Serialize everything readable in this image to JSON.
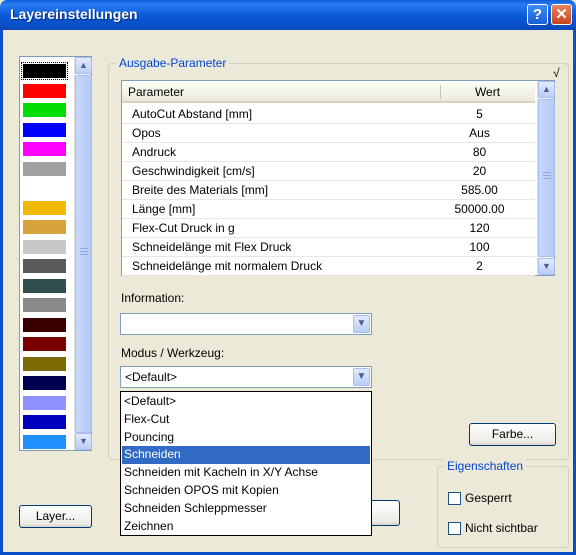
{
  "window": {
    "title": "Layereinstellungen",
    "help_glyph": "?",
    "close_glyph": "✕"
  },
  "colors": {
    "swatches": [
      "#000000",
      "#ff0000",
      "#00dd00",
      "#0000ff",
      "#ff00ff",
      "#a0a0a0",
      "",
      "#f5b800",
      "#d8a33a",
      "#c8c8c8",
      "#5a5a5a",
      "#2f4f4f",
      "#8a8a8a",
      "#3a0000",
      "#7a0000",
      "#7a6a00",
      "#000050",
      "#9090ff",
      "#0000c0",
      "#1e90ff"
    ],
    "scroll_up": "▲",
    "scroll_down": "▼"
  },
  "group": {
    "legend": "Ausgabe-Parameter",
    "check": "√"
  },
  "params": {
    "header_name": "Parameter",
    "header_value": "Wert",
    "rows": [
      {
        "name": "AutoCut Abstand [mm]",
        "value": "5"
      },
      {
        "name": "Opos",
        "value": "Aus"
      },
      {
        "name": "Andruck",
        "value": "80"
      },
      {
        "name": "Geschwindigkeit [cm/s]",
        "value": "20"
      },
      {
        "name": "Breite des Materials [mm]",
        "value": "585.00"
      },
      {
        "name": "Länge [mm]",
        "value": "50000.00"
      },
      {
        "name": "Flex-Cut Druck in g",
        "value": "120"
      },
      {
        "name": "Schneidelänge mit Flex Druck",
        "value": "100"
      },
      {
        "name": "Schneidelänge mit normalem Druck",
        "value": "2"
      }
    ]
  },
  "info": {
    "label": "Information:",
    "value": ""
  },
  "mode": {
    "label": "Modus / Werkzeug:",
    "selected": "<Default>",
    "options": [
      "<Default>",
      "Flex-Cut",
      "Pouncing",
      "Schneiden",
      "Schneiden mit Kacheln in X/Y Achse",
      "Schneiden OPOS mit Kopien",
      "Schneiden Schleppmesser",
      "Zeichnen"
    ],
    "highlighted": "Schneiden",
    "arrow": "▼"
  },
  "buttons": {
    "farbe": "Farbe...",
    "layer": "Layer...",
    "hidden_ok": ""
  },
  "properties": {
    "legend": "Eigenschaften",
    "locked": "Gesperrt",
    "hidden": "Nicht sichtbar"
  }
}
